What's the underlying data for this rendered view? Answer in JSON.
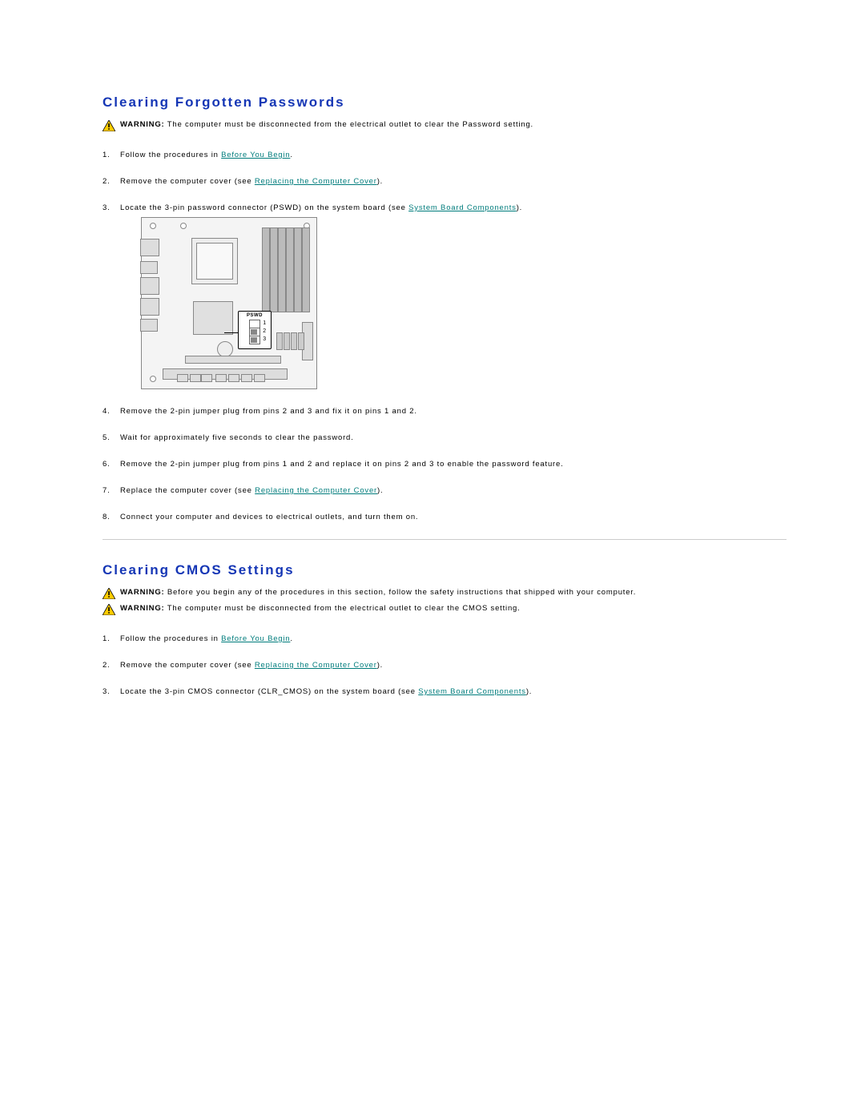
{
  "section1": {
    "title": "Clearing Forgotten Passwords",
    "warning_label": "WARNING:",
    "warning_text": " The computer must be disconnected from the electrical outlet to clear the Password setting.",
    "steps": {
      "s1_pre": "Follow the procedures in ",
      "s1_link": "Before You Begin",
      "s1_post": ".",
      "s2_pre": "Remove the computer cover (see ",
      "s2_link": "Replacing the Computer Cover",
      "s2_post": ").",
      "s3_pre": "Locate the 3-pin password connector (PSWD) on the system board (see ",
      "s3_link": "System Board Components",
      "s3_post": ").",
      "s4": "Remove the 2-pin jumper plug from pins 2 and 3 and fix it on pins 1 and 2.",
      "s5": "Wait for approximately five seconds to clear the password.",
      "s6": "Remove the 2-pin jumper plug from pins 1 and 2 and replace it on pins 2 and 3 to enable the password feature.",
      "s7_pre": "Replace the computer cover (see ",
      "s7_link": "Replacing the Computer Cover",
      "s7_post": ").",
      "s8": "Connect your computer and devices to electrical outlets, and turn them on."
    },
    "callout_label": "PSWD",
    "pin1": "1",
    "pin2": "2",
    "pin3": "3"
  },
  "section2": {
    "title": "Clearing CMOS Settings",
    "warning1_label": "WARNING:",
    "warning1_text": " Before you begin any of the procedures in this section, follow the safety instructions that shipped with your computer.",
    "warning2_label": "WARNING:",
    "warning2_text": " The computer must be disconnected from the electrical outlet to clear the CMOS setting.",
    "steps": {
      "s1_pre": "Follow the procedures in ",
      "s1_link": "Before You Begin",
      "s1_post": ".",
      "s2_pre": "Remove the computer cover (see ",
      "s2_link": "Replacing the Computer Cover",
      "s2_post": ").",
      "s3_pre": "Locate the 3-pin CMOS connector (CLR_CMOS) on the system board (see ",
      "s3_link": "System Board Components",
      "s3_post": ")."
    }
  }
}
